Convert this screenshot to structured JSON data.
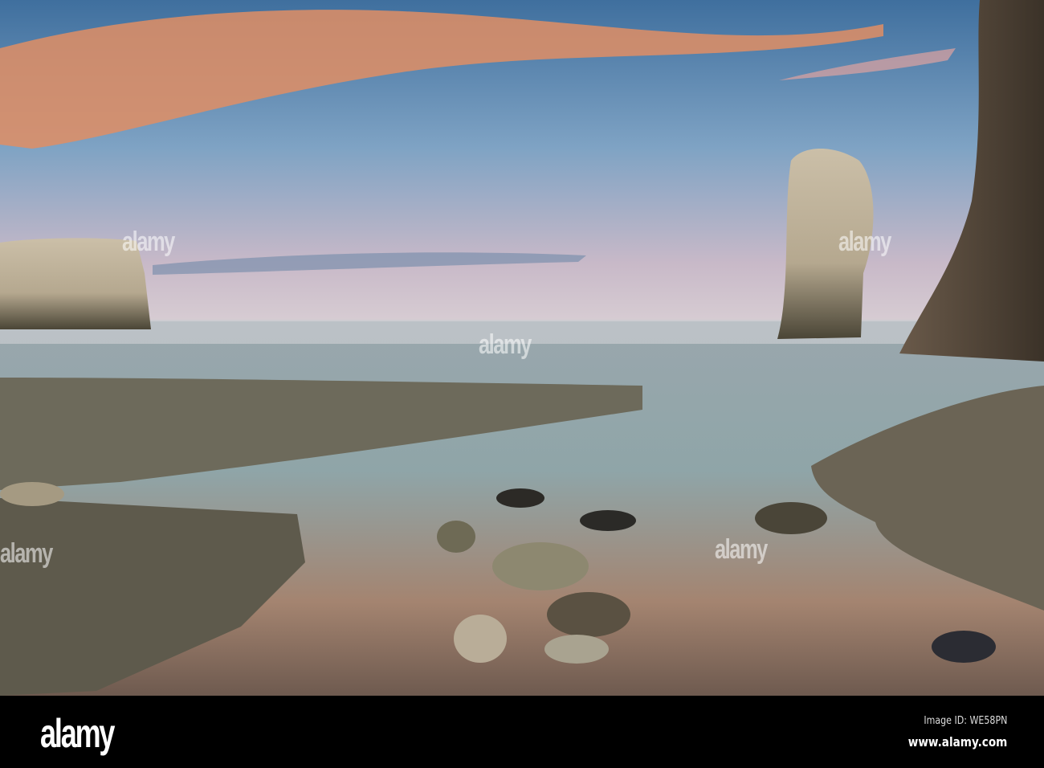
{
  "watermark": "alamy",
  "footer": {
    "logo": "alamy",
    "image_id": "Image ID: WE58PN",
    "url": "www.alamy.com"
  }
}
